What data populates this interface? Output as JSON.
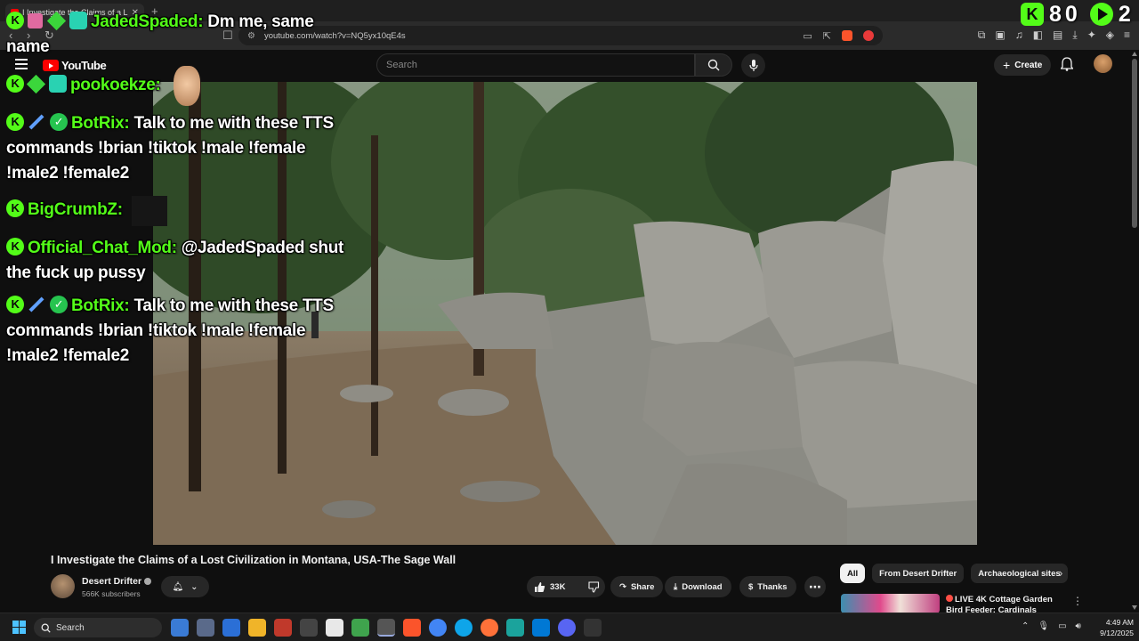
{
  "browser": {
    "tab_title": "I Investigate the Claims of a L",
    "url": "youtube.com/watch?v=NQ5yx10qE4s"
  },
  "youtube": {
    "logo_text": "YouTube",
    "search_placeholder": "Search",
    "create_label": "Create"
  },
  "video": {
    "title": "I Investigate the Claims of a Lost Civilization in Montana, USA-The Sage Wall",
    "channel_name": "Desert Drifter",
    "subscribers": "566K subscribers",
    "likes": "33K",
    "share_label": "Share",
    "download_label": "Download",
    "thanks_label": "Thanks"
  },
  "chips": {
    "all": "All",
    "from_channel": "From Desert Drifter",
    "topic": "Archaeological sites"
  },
  "recommendation": {
    "title": "LIVE 4K Cottage Garden Bird Feeder: Cardinals"
  },
  "chat": [
    {
      "user": "JadedSpaded:",
      "text": "Dm me, same name"
    },
    {
      "user": "pookoekze:",
      "text": ""
    },
    {
      "user": "BotRix:",
      "text": "Talk to me with these TTS commands !brian !tiktok !male !female !male2 !female2"
    },
    {
      "user": "BigCrumbZ:",
      "text": ""
    },
    {
      "user": "Official_Chat_Mod:",
      "text": "@JadedSpaded shut the fuck up pussy"
    },
    {
      "user": "BotRix:",
      "text": "Talk to me with these TTS commands !brian !tiktok !male !female !male2 !female2"
    }
  ],
  "stream_stats": {
    "viewers": "80",
    "count2": "2"
  },
  "taskbar": {
    "search_label": "Search",
    "time": "4:49 AM",
    "date": "9/12/2025"
  },
  "colors": {
    "kick_green": "#53fc18",
    "youtube_red": "#ff0000",
    "background": "#0f0f0f"
  }
}
